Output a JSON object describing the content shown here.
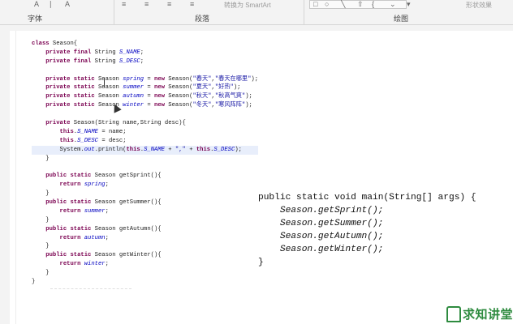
{
  "ribbon": {
    "groups": [
      {
        "label": "字体"
      },
      {
        "label": "段落"
      },
      {
        "label": "绘图"
      }
    ],
    "smartart_label": "转换为 SmartArt",
    "shape_effect_label": "形状效果"
  },
  "code_lines": [
    "class Season{",
    "    private final String S_NAME;",
    "    private final String S_DESC;",
    "",
    "    private static Season spring = new Season(\"春天\",\"春天在哪里\");",
    "    private static Season summer = new Season(\"夏天\",\"好热\");",
    "    private static Season autumn = new Season(\"秋天\",\"秋高气爽\");",
    "    private static Season winter = new Season(\"冬天\",\"寒风阵阵\");",
    "",
    "    private Season(String name,String desc){",
    "        this.S_NAME = name;",
    "        this.S_DESC = desc;",
    "        System.out.println(this.S_NAME + \",\" + this.S_DESC);",
    "    }",
    "",
    "    public static Season getSprint(){",
    "        return spring;",
    "    }",
    "    public static Season getSummer(){",
    "        return summer;",
    "    }",
    "    public static Season getAutumn(){",
    "        return autumn;",
    "    }",
    "    public static Season getWinter(){",
    "        return winter;",
    "    }",
    "}"
  ],
  "snippet_lines": [
    "public static void main(String[] args) {",
    "    Season.getSprint();",
    "    Season.getSummer();",
    "    Season.getAutumn();",
    "    Season.getWinter();",
    "}"
  ],
  "logo": {
    "text": "求知讲堂"
  }
}
